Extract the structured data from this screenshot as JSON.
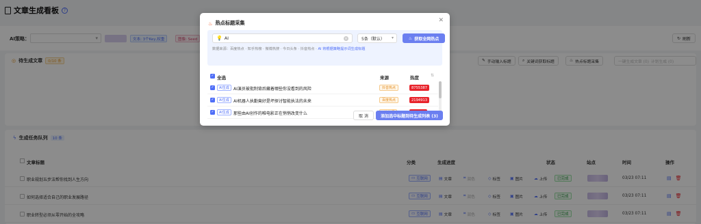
{
  "page": {
    "title": "文章生成看板"
  },
  "filters": {
    "label": "AI策略：",
    "chip1": "文本: 3个Key,权重",
    "chip2": "图像: Seed"
  },
  "toolbar": {
    "refresh": "刷新"
  },
  "pending": {
    "title": "待生成文章",
    "count": "0/10 条",
    "tools": [
      "手动输入标题",
      "关键词获取标题",
      "热点标题采集",
      "一键生成文章 (0)",
      "计划生成 (0)"
    ]
  },
  "tasks": {
    "title": "生成任务队列",
    "count": "10 条",
    "columns": {
      "title": "文章标题",
      "category": "分类",
      "progress": "生成进度",
      "status": "状态",
      "site": "站点",
      "time": "时间",
      "ops": "操作"
    },
    "rows": [
      {
        "title": "职业规划五步法帮你找到人生方向",
        "category": "互联网",
        "steps": [
          "文章",
          "润色",
          "标签",
          "图片",
          "上传"
        ],
        "status": "已完成",
        "time": "03/23 07:11"
      },
      {
        "title": "如何选择适合自己的职业发展路径",
        "category": "互联网",
        "steps": [
          "文章",
          "润色",
          "标签",
          "图片",
          "上传"
        ],
        "status": "已完成",
        "time": "03/23 07:11"
      },
      {
        "title": "职业转型必须从零开始的全攻略",
        "category": "互联网",
        "steps": [
          "文章",
          "润色",
          "标签",
          "图片",
          "上传"
        ],
        "status": "已完成",
        "time": "03/23 07:11"
      }
    ]
  },
  "modal": {
    "title": "热点标题采集",
    "search_value": "AI",
    "count_value": "5条（默认）",
    "fetch": "获取全网热点",
    "source_line": "数据来源：百度热点 · 知乎热榜 · 微博热搜 · 今日头条 · 抖音热点 ·",
    "source_hint": "AI 将根据策略提示词生成标题",
    "headers": {
      "select_all": "全选",
      "source": "来源",
      "heat": "热度"
    },
    "items": [
      {
        "tag": "AI生成",
        "title": "AI演员被批制背后藏着哪些你没看到的风险",
        "source": "抖音热点",
        "heat": "8755387"
      },
      {
        "tag": "AI生成",
        "title": "AI机器人执勤竟好是坏探讨智能执法的未来",
        "source": "百度热点",
        "heat": "2194913"
      },
      {
        "tag": "AI生成",
        "title": "那些由AI创作的唯电影正在悄悄改变什么",
        "source": "B站热门",
        "heat": "804813"
      }
    ],
    "cancel": "取 消",
    "confirm": "添加选中标题到待生成列表 (3)"
  },
  "colors": {
    "accent": "#6b7ff0",
    "heat": "#e8232b",
    "success": "#2e9c44"
  }
}
